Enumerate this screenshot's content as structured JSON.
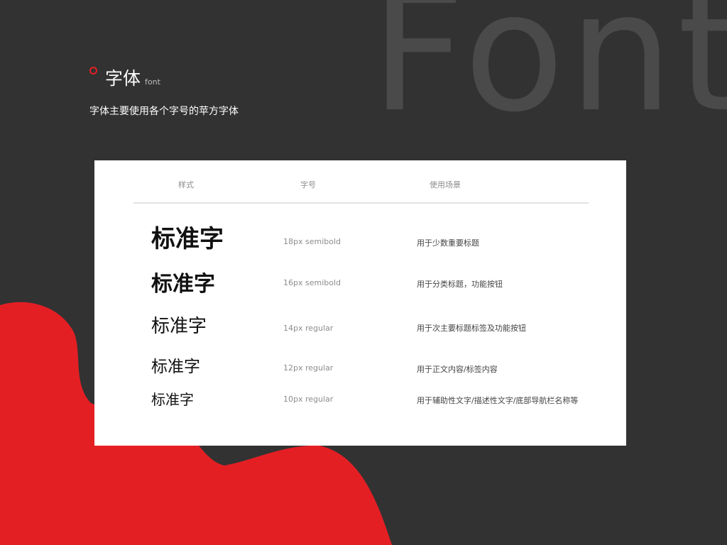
{
  "background_word": "Font",
  "colors": {
    "background": "#323232",
    "accent_red": "#e41f24",
    "card": "#ffffff"
  },
  "header": {
    "title": "字体",
    "title_en": "font",
    "subtitle": "字体主要使用各个字号的苹方字体"
  },
  "table": {
    "columns": [
      "样式",
      "字号",
      "使用场景"
    ],
    "rows": [
      {
        "sample": "标准字",
        "size": "18px semibold",
        "usage": "用于少数重要标题"
      },
      {
        "sample": "标准字",
        "size": "16px semibold",
        "usage": "用于分类标题，功能按钮"
      },
      {
        "sample": "标准字",
        "size": "14px regular",
        "usage": "用于次主要标题标签及功能按钮"
      },
      {
        "sample": "标准字",
        "size": "12px regular",
        "usage": "用于正文内容/标签内容"
      },
      {
        "sample": "标准字",
        "size": "10px regular",
        "usage": "用于辅助性文字/描述性文字/底部导航栏名称等"
      }
    ]
  }
}
